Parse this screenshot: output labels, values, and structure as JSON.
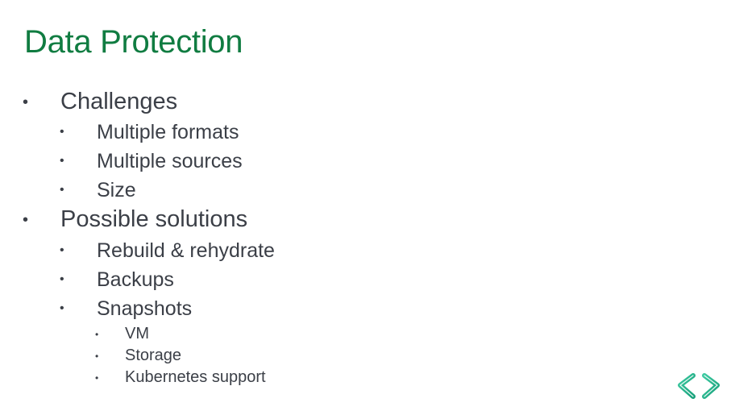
{
  "slide": {
    "title": "Data Protection",
    "bullet_glyph": "•",
    "items": [
      {
        "label": "Challenges",
        "children": [
          {
            "label": "Multiple formats"
          },
          {
            "label": "Multiple sources"
          },
          {
            "label": "Size"
          }
        ]
      },
      {
        "label": "Possible solutions",
        "children": [
          {
            "label": "Rebuild & rehydrate"
          },
          {
            "label": "Backups"
          },
          {
            "label": "Snapshots",
            "children": [
              {
                "label": "VM"
              },
              {
                "label": "Storage"
              },
              {
                "label": "Kubernetes support"
              }
            ]
          }
        ]
      }
    ]
  },
  "colors": {
    "title": "#107c41",
    "text": "#3b3f47",
    "logo_light": "#3cc9a0",
    "logo_dark": "#17a07a"
  },
  "logo": {
    "icon": "code-brackets-logo"
  }
}
